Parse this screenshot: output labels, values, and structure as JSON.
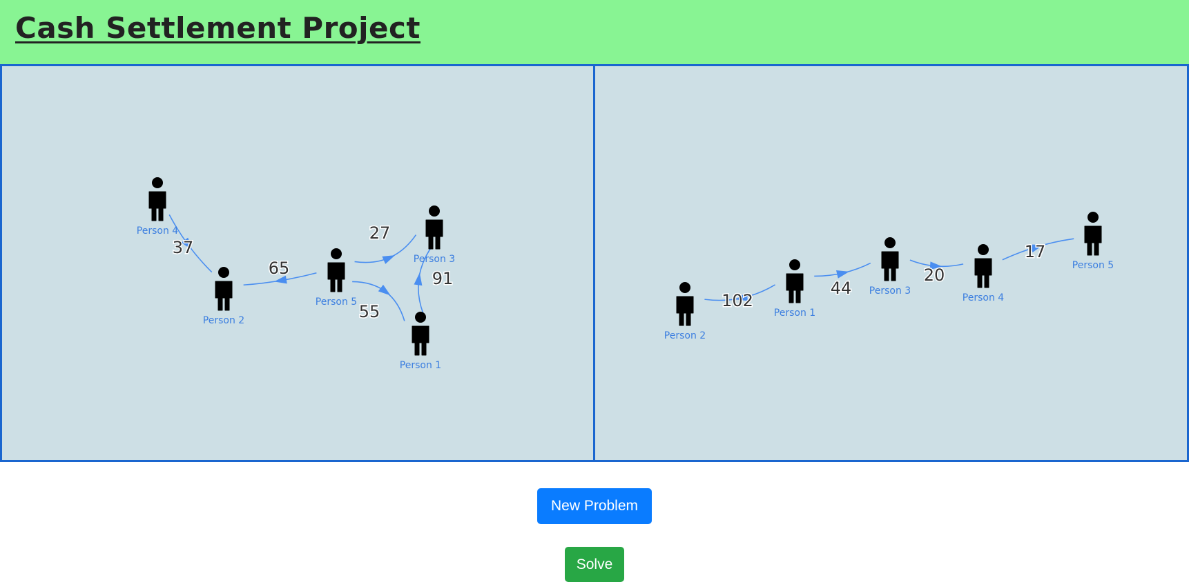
{
  "header": {
    "title": "Cash Settlement Project"
  },
  "buttons": {
    "new_problem": "New Problem",
    "solve": "Solve"
  },
  "colors": {
    "header_bg": "#88f493",
    "panel_bg": "#cddfe5",
    "panel_border": "#1a66cf",
    "edge": "#4a8ef0",
    "node": "#000000",
    "node_label": "#3b7ee0",
    "new_problem_button": "#0a7cff",
    "solve_button": "#28a745"
  },
  "graphs": {
    "problem": {
      "nodes": [
        "Person 4",
        "Person 2",
        "Person 5",
        "Person 3",
        "Person 1"
      ],
      "edges": [
        {
          "from": "Person 4",
          "to": "Person 2",
          "amount": "37"
        },
        {
          "from": "Person 5",
          "to": "Person 2",
          "amount": "65"
        },
        {
          "from": "Person 5",
          "to": "Person 3",
          "amount": "27"
        },
        {
          "from": "Person 1",
          "to": "Person 3",
          "amount": "91"
        },
        {
          "from": "Person 5",
          "to": "Person 1",
          "amount": "55"
        }
      ]
    },
    "solution": {
      "nodes": [
        "Person 2",
        "Person 1",
        "Person 3",
        "Person 4",
        "Person 5"
      ],
      "edges": [
        {
          "from": "Person 1",
          "to": "Person 2",
          "amount": "102"
        },
        {
          "from": "Person 1",
          "to": "Person 3",
          "amount": "44"
        },
        {
          "from": "Person 3",
          "to": "Person 4",
          "amount": "20"
        },
        {
          "from": "Person 4",
          "to": "Person 5",
          "amount": "17"
        }
      ]
    }
  }
}
